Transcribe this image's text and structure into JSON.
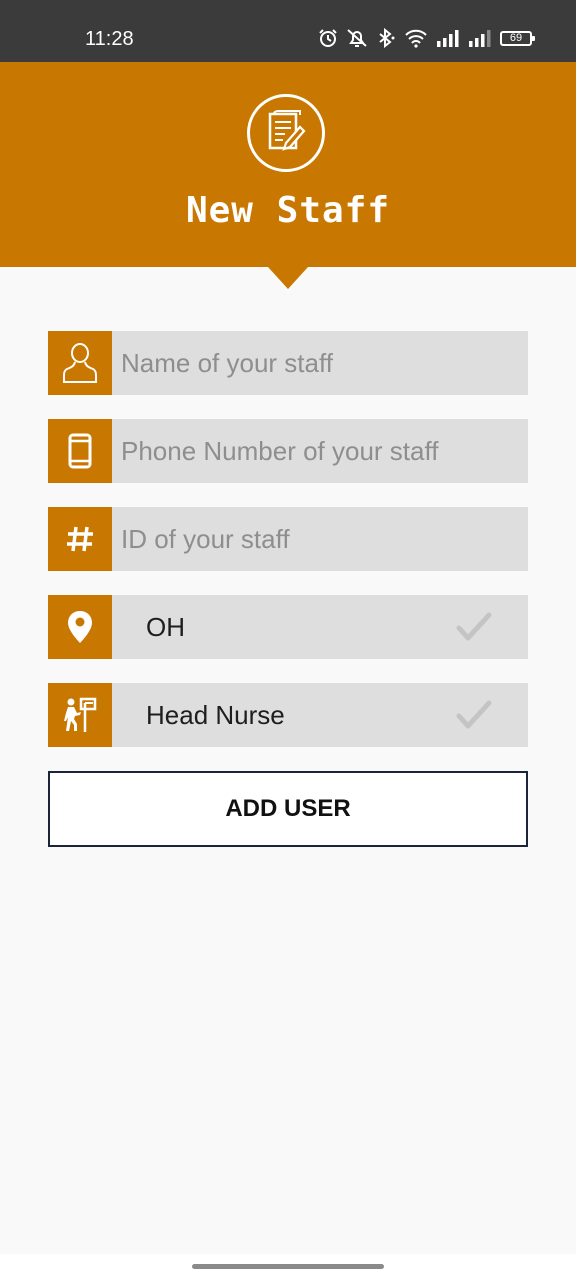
{
  "status_bar": {
    "time": "11:28",
    "battery": "69",
    "icons": [
      "alarm-icon",
      "notifications-off-icon",
      "bluetooth-icon",
      "wifi-icon",
      "signal-icon",
      "signal-icon",
      "battery-icon"
    ]
  },
  "header": {
    "title": "New Staff",
    "icon": "edit-document-icon",
    "color": "#c87800"
  },
  "form": {
    "name": {
      "placeholder": "Name of your staff",
      "value": "",
      "icon": "person-icon"
    },
    "phone": {
      "placeholder": "Phone Number of your staff",
      "value": "",
      "icon": "phone-icon"
    },
    "id": {
      "placeholder": "ID of your staff",
      "value": "",
      "icon": "hash-icon"
    },
    "location": {
      "value": "OH",
      "icon": "location-pin-icon"
    },
    "role": {
      "value": "Head Nurse",
      "icon": "staff-sign-icon"
    }
  },
  "actions": {
    "add_user_label": "ADD USER"
  }
}
